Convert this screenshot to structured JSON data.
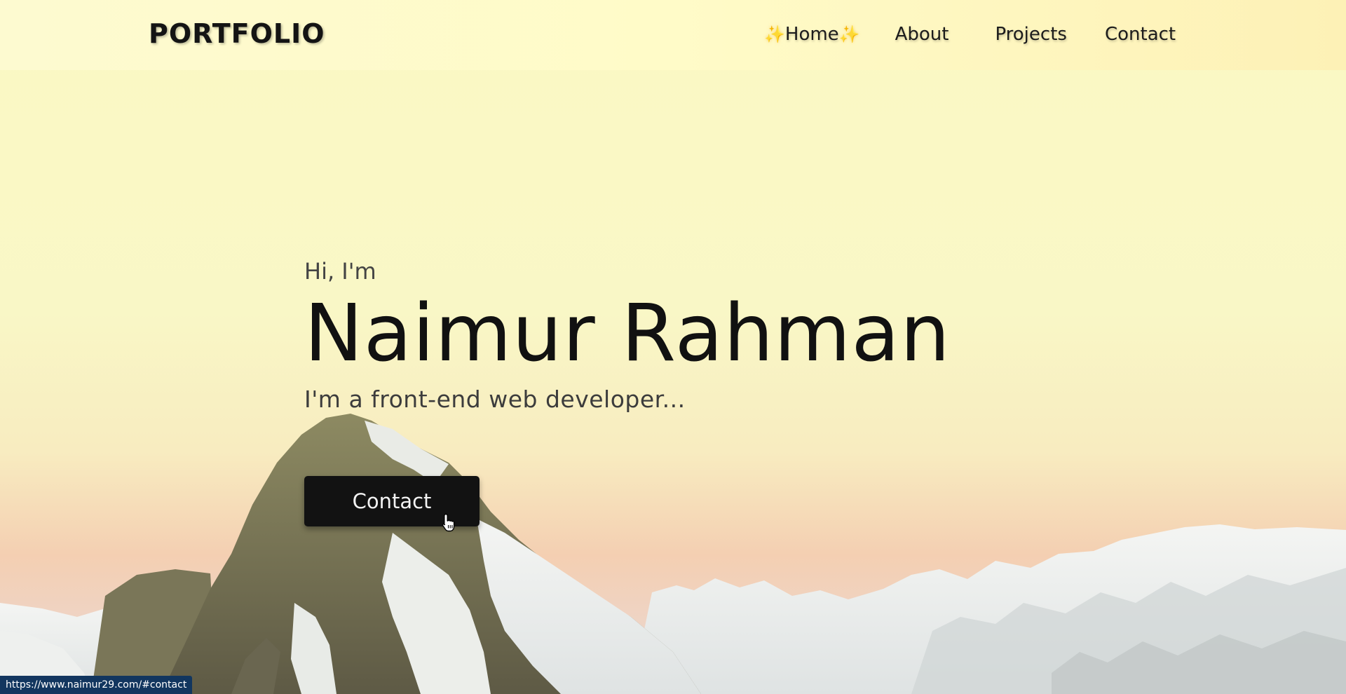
{
  "brand": {
    "logo": "PORTFOLIO"
  },
  "nav": {
    "sparkle": "✨",
    "items": [
      {
        "label": "Home",
        "active": true
      },
      {
        "label": "About"
      },
      {
        "label": "Projects"
      },
      {
        "label": "Contact"
      }
    ]
  },
  "hero": {
    "greeting": "Hi, I'm",
    "name": "Naimur Rahman",
    "role": "I'm a front-end web developer...",
    "cta_label": "Contact"
  },
  "status_bar": {
    "url": "https://www.naimur29.com/#contact"
  },
  "colors": {
    "text_dark": "#111111",
    "button_bg": "#121212",
    "sparkle": "#f0b43c",
    "status_bg": "#12365f"
  },
  "icons": {
    "cursor": "hand-pointer-icon",
    "sparkle": "sparkles-icon"
  }
}
